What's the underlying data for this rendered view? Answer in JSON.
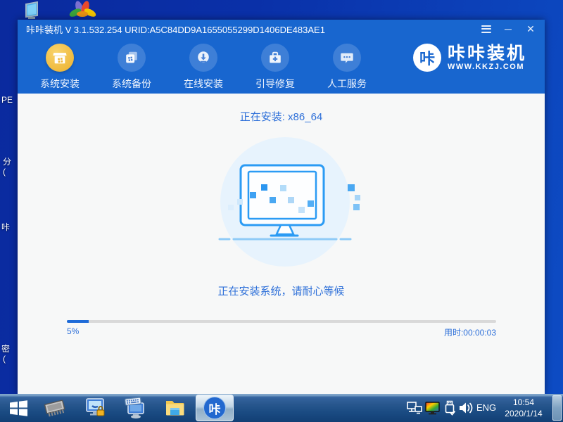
{
  "desktop": {
    "fragments": [
      "PE",
      "分",
      "(",
      "咔",
      "密",
      "("
    ],
    "icons": [
      "display-icon",
      "image-viewer-flower-icon"
    ]
  },
  "window": {
    "title": "咔咔装机 V 3.1.532.254 URID:A5C84DD9A1655055299D1406DE483AE1",
    "controls": {
      "minimize": "─",
      "close": "✕"
    },
    "nav": {
      "items": [
        {
          "label": "系统安装",
          "icon": "package-install-icon",
          "active": true
        },
        {
          "label": "系统备份",
          "icon": "system-backup-icon",
          "active": false
        },
        {
          "label": "在线安装",
          "icon": "online-download-icon",
          "active": false
        },
        {
          "label": "引导修复",
          "icon": "boot-repair-toolbox-icon",
          "active": false
        },
        {
          "label": "人工服务",
          "icon": "chat-support-icon",
          "active": false
        }
      ]
    },
    "brand": {
      "logo_char": "咔",
      "name": "咔咔装机",
      "url": "WWW.KKZJ.COM"
    },
    "main": {
      "status_title": "正在安装: x86_64",
      "message": "正在安装系统，请耐心等候",
      "progress": {
        "percent": 5,
        "percent_label": "5%",
        "elapsed_label": "用时:00:00:03"
      }
    }
  },
  "taskbar": {
    "apps": [
      "start-button",
      "memory-chip-icon",
      "monitor-lock-icon",
      "keyboard-input-icon",
      "file-explorer-icon",
      "kaka-app-button"
    ],
    "tray": {
      "language": "ENG",
      "time": "10:54",
      "date": "2020/1/14"
    }
  },
  "colors": {
    "window_blue": "#1866cf",
    "accent_text": "#2e70d9",
    "active_gold": "#efb93c",
    "progress_fill": "#1e6bd8",
    "illustration_blue": "#2b9bf4",
    "content_bg": "#f7f8f8"
  }
}
